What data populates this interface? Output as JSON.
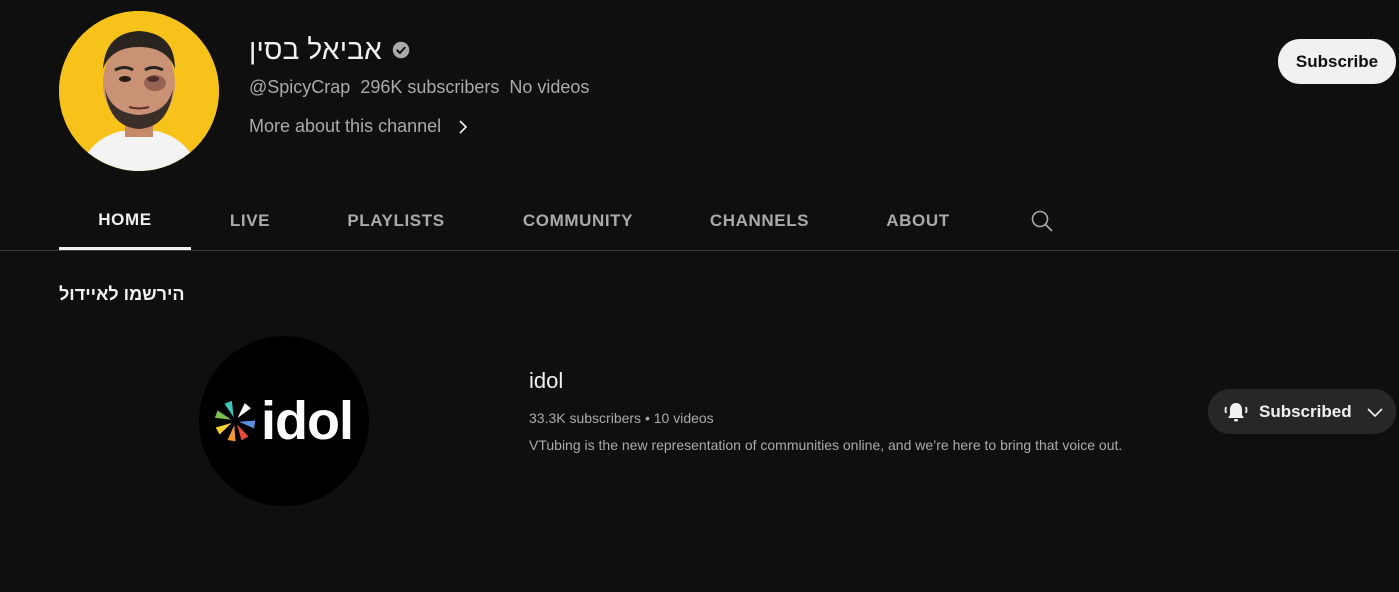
{
  "channel": {
    "name": "אביאל בסין",
    "handle": "@SpicyCrap",
    "subscribers": "296K subscribers",
    "videos": "No videos",
    "more_about": "More about this channel",
    "subscribe_label": "Subscribe",
    "icons": {
      "avatar": "channel-avatar",
      "verified": "verified-check-icon",
      "more": "chevron-right-icon"
    }
  },
  "tabs": [
    {
      "label": "HOME",
      "active": true
    },
    {
      "label": "LIVE",
      "active": false
    },
    {
      "label": "PLAYLISTS",
      "active": false
    },
    {
      "label": "COMMUNITY",
      "active": false
    },
    {
      "label": "CHANNELS",
      "active": false
    },
    {
      "label": "ABOUT",
      "active": false
    }
  ],
  "tab_search_icon": "search-icon",
  "section": {
    "title": "הירשמו לאיידול",
    "featured": {
      "logo_text": "idol",
      "name": "idol",
      "subscribers": "33.3K subscribers",
      "separator": "•",
      "videos": "10 videos",
      "description": "VTubing is the new representation of communities online, and we’re here to bring that voice out.",
      "subscribed_label": "Subscribed",
      "icons": {
        "bell": "bell-ringing-icon",
        "dropdown": "chevron-down-icon"
      }
    }
  },
  "colors": {
    "background": "#0f0f0f",
    "text_primary": "#f1f1f1",
    "text_secondary": "#aaaaaa",
    "button_light": "#f1f1f1",
    "button_dark": "#272727",
    "divider": "#3f3f3f",
    "avatar_bg": "#f7c21a"
  }
}
